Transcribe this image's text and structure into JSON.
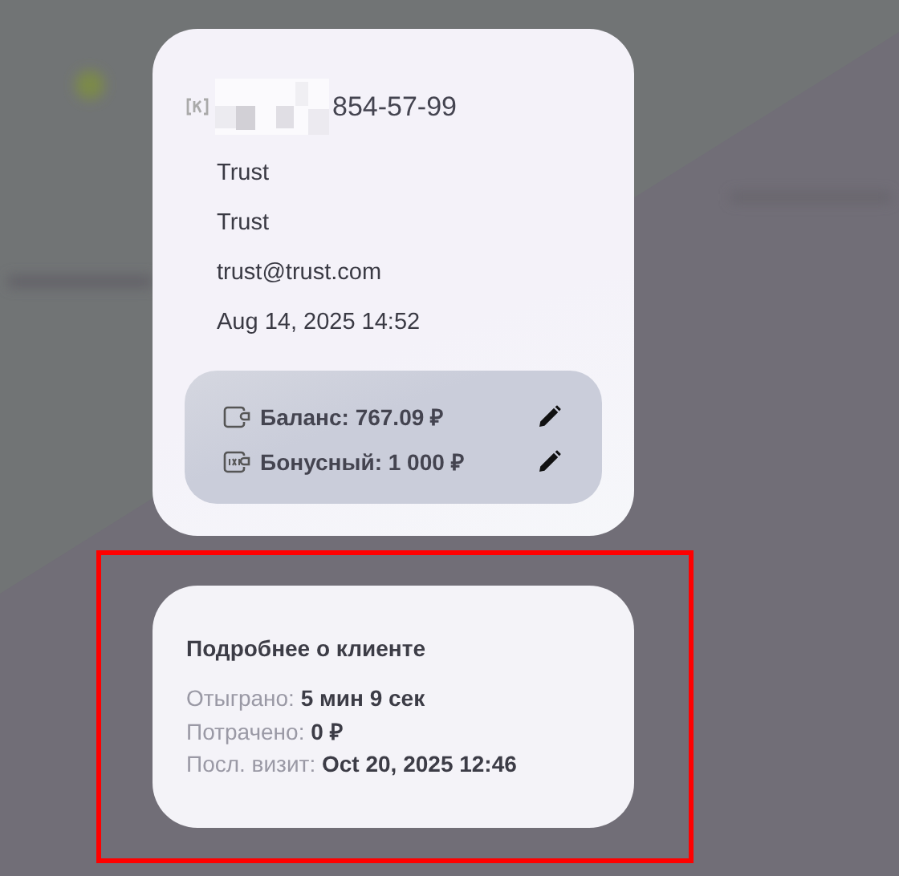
{
  "client": {
    "phone": "854-57-99",
    "fields": [
      "Trust",
      "Trust",
      "trust@trust.com",
      "Aug 14, 2025 14:52"
    ]
  },
  "balances": [
    {
      "kind": "wallet",
      "text": "Баланс: 767.09 ₽"
    },
    {
      "kind": "bonus",
      "text": "Бонусный: 1 000 ₽"
    }
  ],
  "details": {
    "title": "Подробнее о клиенте",
    "highlighted": true,
    "rows": [
      "Отыграно: **5 мин 9 сек**",
      "Потрачено: **0 ₽**",
      "Посл. визит: **Oct 20, 2025 12:46**"
    ]
  }
}
